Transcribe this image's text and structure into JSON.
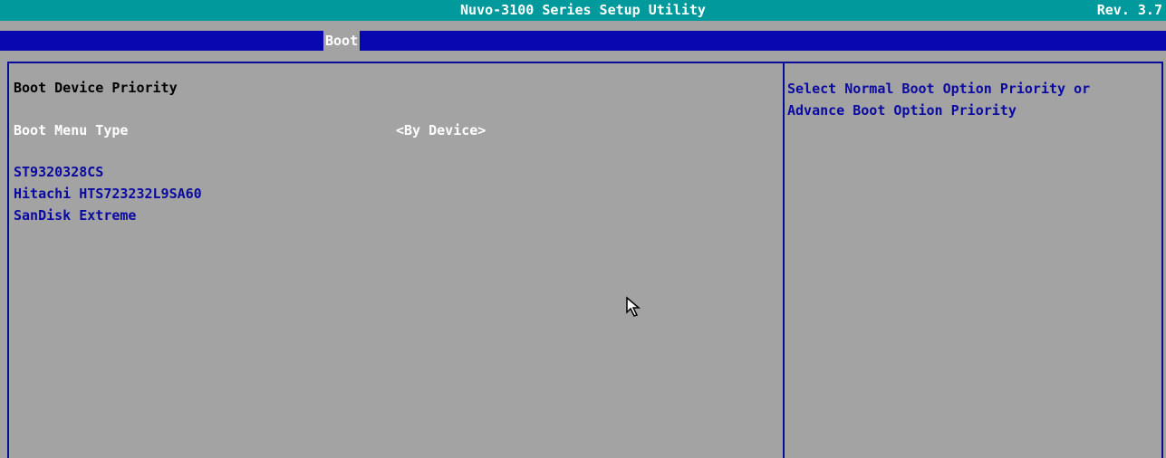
{
  "header": {
    "title": "Nuvo-3100 Series Setup Utility",
    "revision": "Rev. 3.7"
  },
  "menu": {
    "active_tab": "Boot"
  },
  "main": {
    "section_title": "Boot Device Priority",
    "boot_menu_type": {
      "label": "Boot Menu Type",
      "value": "<By Device>"
    },
    "devices": [
      "ST9320328CS",
      "Hitachi HTS723232L9SA60",
      "SanDisk Extreme"
    ]
  },
  "help": {
    "text": "Select Normal Boot Option Priority or Advance Boot Option Priority"
  },
  "colors": {
    "title_bar": "#009a9c",
    "menu_bar": "#0808b0",
    "panel_bg": "#a3a3a3",
    "text_blue": "#0a0aa0"
  },
  "icons": {
    "pointer": "mouse-pointer-icon"
  }
}
